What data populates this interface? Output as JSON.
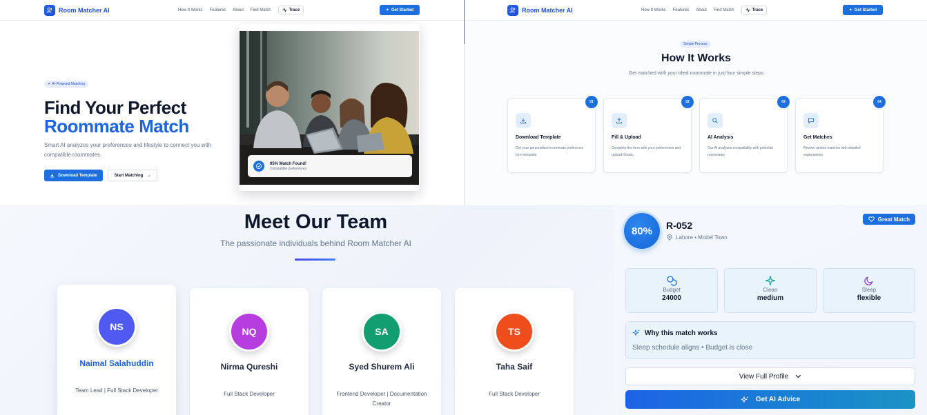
{
  "hero_nav": {
    "logo": "Room Matcher AI",
    "links": [
      "How It Works",
      "Features",
      "About",
      "Find Match"
    ],
    "trace": "Trace",
    "cta": "Get Started"
  },
  "how_nav": {
    "logo": "Room Matcher AI",
    "links": [
      "How It Works",
      "Features",
      "About",
      "Find Match"
    ],
    "trace": "Trace",
    "cta": "Get Started"
  },
  "hero": {
    "badge": "AI-Powered Matching",
    "title_line1": "Find Your Perfect",
    "title_line2": "Roommate Match",
    "description": "Smart AI analyzes your preferences and lifestyle to connect you with compatible roommates.",
    "primary_button": "Download Template",
    "secondary_button": "Start Matching",
    "match_card": {
      "title": "95% Match Found!",
      "subtitle": "Compatible preferences"
    }
  },
  "how": {
    "badge": "Simple Process",
    "title": "How It Works",
    "subtitle": "Get matched with your ideal roommate in just four simple steps",
    "steps": [
      {
        "num": "01",
        "icon": "download-icon",
        "title": "Download Template",
        "desc": "Get your personalized roommate preference form template"
      },
      {
        "num": "02",
        "icon": "upload-icon",
        "title": "Fill & Upload",
        "desc": "Complete the form with your preferences and upload it back"
      },
      {
        "num": "03",
        "icon": "search-icon",
        "title": "AI Analysis",
        "desc": "Our AI analyzes compatibility with potential roommates"
      },
      {
        "num": "04",
        "icon": "chat-icon",
        "title": "Get Matches",
        "desc": "Review ranked matches with detailed explanations"
      }
    ]
  },
  "team": {
    "title": "Meet Our Team",
    "subtitle": "The passionate individuals behind Room Matcher AI",
    "members": [
      {
        "initials": "NS",
        "name": "Naimal Salahuddin",
        "role": "Team Lead | Full Stack Developer",
        "color": "#4f5bf0"
      },
      {
        "initials": "NQ",
        "name": "Nirma Qureshi",
        "role": "Full Stack Developer",
        "color": "#b63ee0"
      },
      {
        "initials": "SA",
        "name": "Syed Shurem Ali",
        "role": "Frontend Developer | Documentation Creator",
        "color": "#129e70"
      },
      {
        "initials": "TS",
        "name": "Taha Saif",
        "role": "Full Stack Developer",
        "color": "#ef4d1c"
      }
    ]
  },
  "match": {
    "score": "80%",
    "room_id": "R-052",
    "location": "Lahore • Model Town",
    "badge": "Great Match",
    "stats": [
      {
        "icon": "coins-icon",
        "label": "Budget",
        "value": "24000"
      },
      {
        "icon": "sparkle-icon",
        "label": "Clean",
        "value": "medium"
      },
      {
        "icon": "moon-icon",
        "label": "Sleep",
        "value": "flexible"
      }
    ],
    "why_title": "Why this match works",
    "why_text": "Sleep schedule aligns • Budget is close",
    "view_button": "View Full Profile",
    "ai_button": "Get AI Advice"
  },
  "colors": {
    "brand_blue": "#1d6fe0",
    "accent_blue": "#1e63e0",
    "panel_tint": "#e9f3fc"
  }
}
